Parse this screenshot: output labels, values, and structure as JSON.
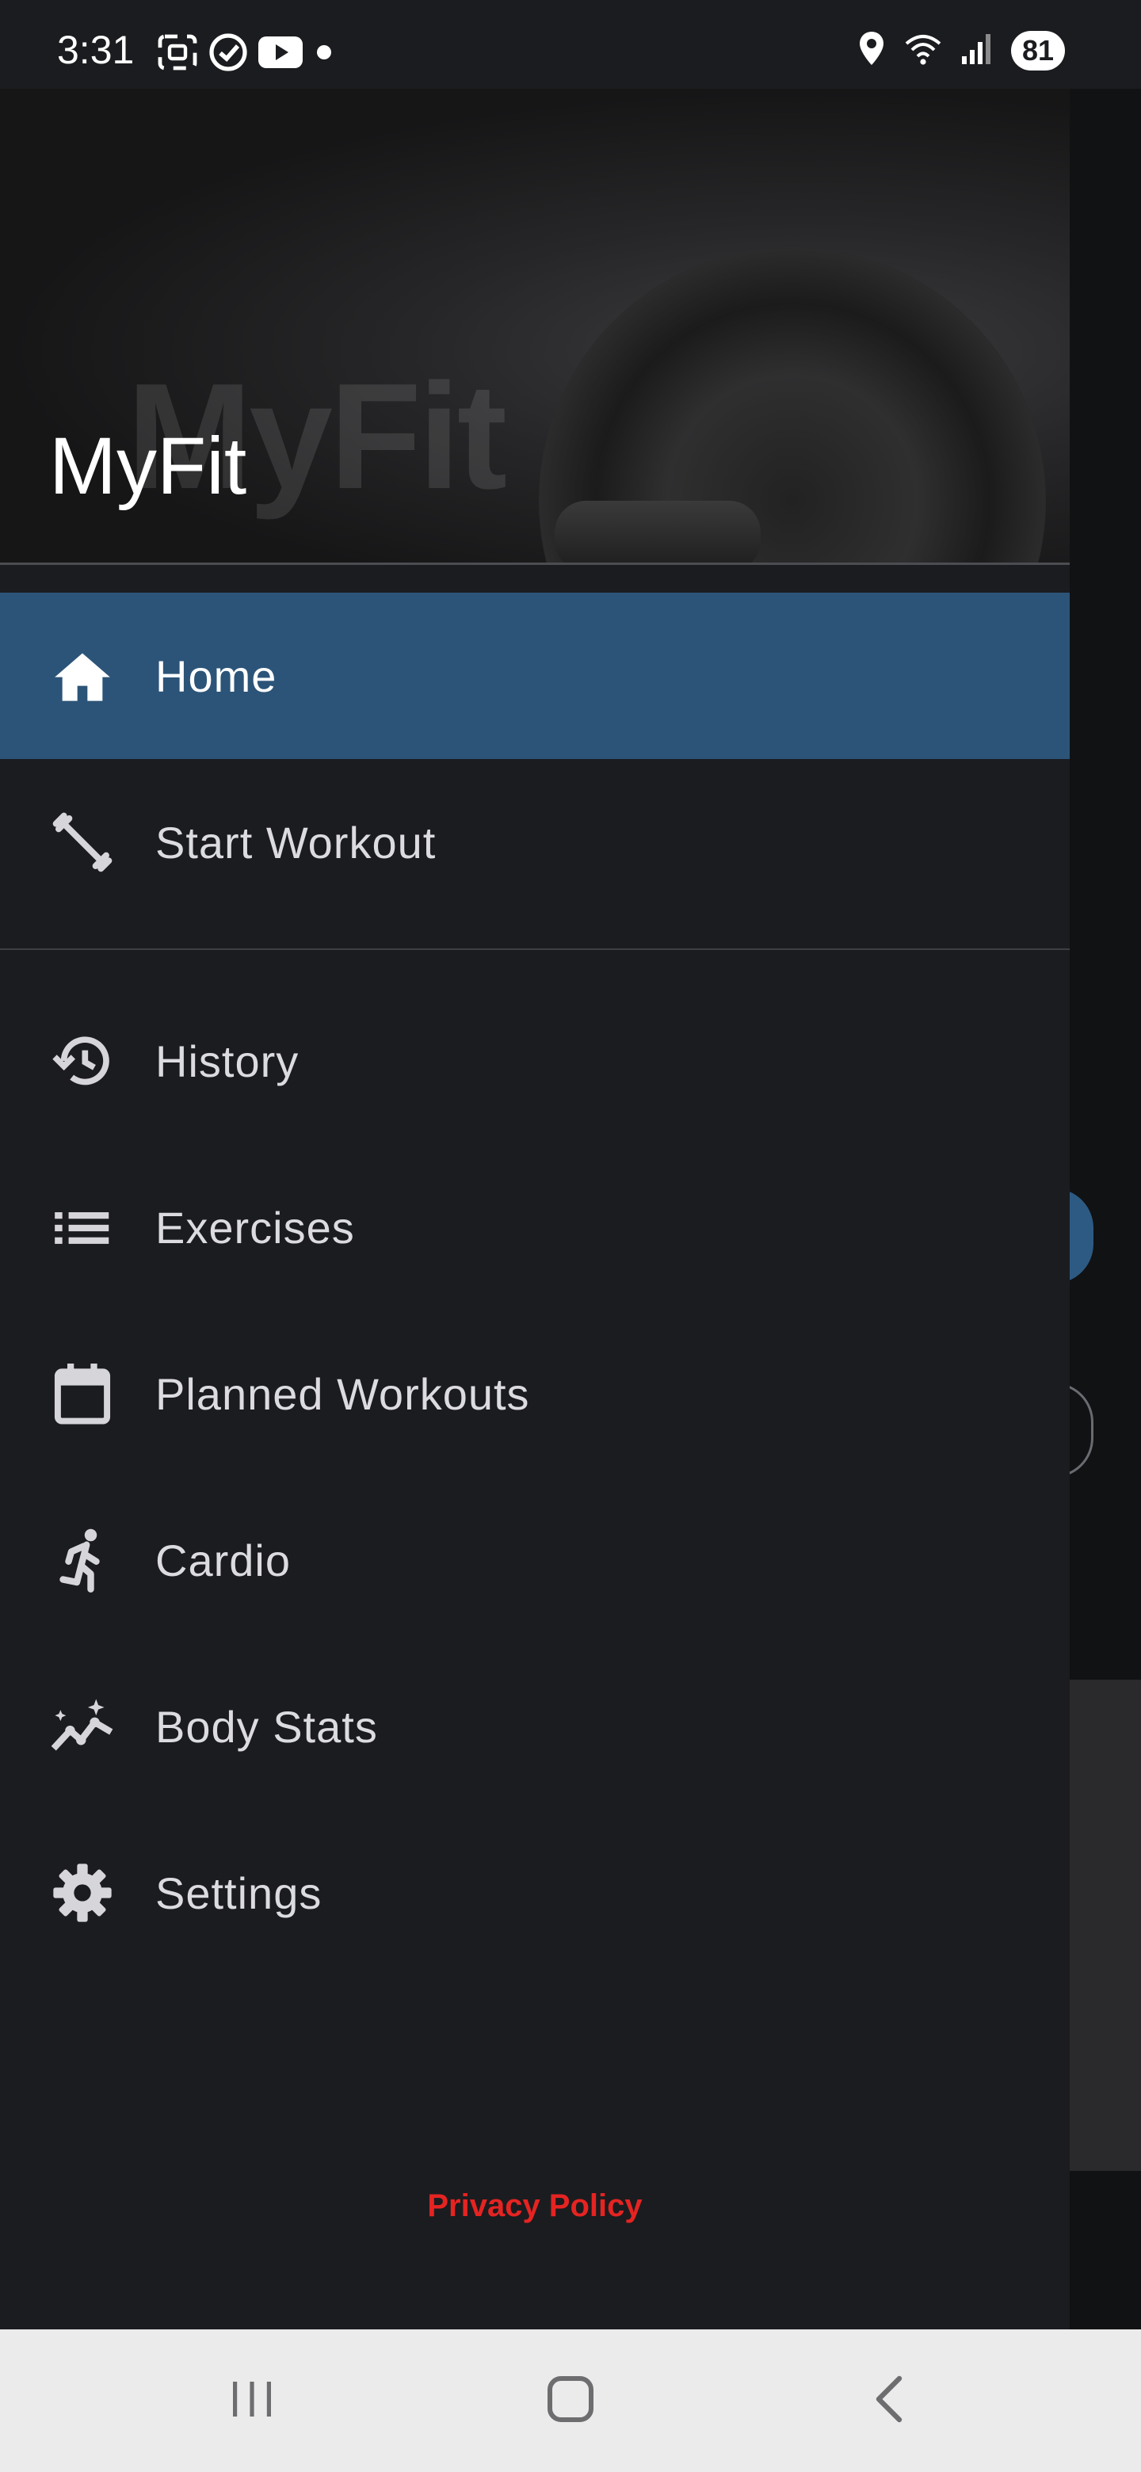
{
  "status_bar": {
    "time": "3:31",
    "battery": "81"
  },
  "header": {
    "title": "MyFit",
    "watermark": "MyFit"
  },
  "menu": {
    "items": [
      {
        "label": "Home",
        "icon": "home-icon",
        "active": true
      },
      {
        "label": "Start Workout",
        "icon": "dumbbell-icon",
        "active": false
      },
      {
        "label": "History",
        "icon": "history-icon",
        "active": false
      },
      {
        "label": "Exercises",
        "icon": "list-icon",
        "active": false
      },
      {
        "label": "Planned Workouts",
        "icon": "calendar-icon",
        "active": false
      },
      {
        "label": "Cardio",
        "icon": "running-icon",
        "active": false
      },
      {
        "label": "Body Stats",
        "icon": "stats-sparkle-icon",
        "active": false
      },
      {
        "label": "Settings",
        "icon": "gear-icon",
        "active": false
      }
    ]
  },
  "footer": {
    "privacy_label": "Privacy Policy"
  },
  "colors": {
    "active_background": "#2c5478",
    "drawer_background": "#1b1c1f",
    "privacy_link": "#e52422"
  }
}
